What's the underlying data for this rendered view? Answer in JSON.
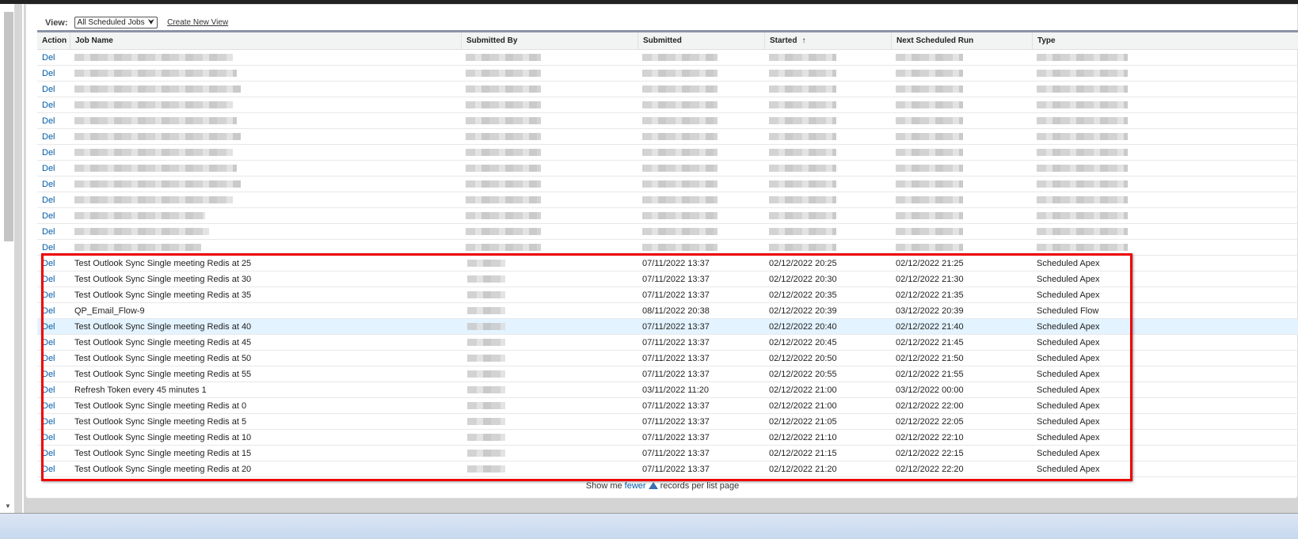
{
  "view": {
    "label": "View:",
    "selected": "All Scheduled Jobs",
    "create_link": "Create New View"
  },
  "columns": [
    "Action",
    "Job Name",
    "Submitted By",
    "Submitted",
    "Started",
    "Next Scheduled Run",
    "Type"
  ],
  "sort_indicator": "↑",
  "del_label": "Del",
  "blurred_row_count": 13,
  "rows": [
    {
      "job": "Test Outlook Sync Single meeting Redis at 25",
      "submitted": "07/11/2022 13:37",
      "started": "02/12/2022 20:25",
      "next": "02/12/2022 21:25",
      "type": "Scheduled Apex"
    },
    {
      "job": "Test Outlook Sync Single meeting Redis at 30",
      "submitted": "07/11/2022 13:37",
      "started": "02/12/2022 20:30",
      "next": "02/12/2022 21:30",
      "type": "Scheduled Apex"
    },
    {
      "job": "Test Outlook Sync Single meeting Redis at 35",
      "submitted": "07/11/2022 13:37",
      "started": "02/12/2022 20:35",
      "next": "02/12/2022 21:35",
      "type": "Scheduled Apex"
    },
    {
      "job": "QP_Email_Flow-9",
      "submitted": "08/11/2022 20:38",
      "started": "02/12/2022 20:39",
      "next": "03/12/2022 20:39",
      "type": "Scheduled Flow"
    },
    {
      "job": "Test Outlook Sync Single meeting Redis at 40",
      "submitted": "07/11/2022 13:37",
      "started": "02/12/2022 20:40",
      "next": "02/12/2022 21:40",
      "type": "Scheduled Apex",
      "highlighted": true
    },
    {
      "job": "Test Outlook Sync Single meeting Redis at 45",
      "submitted": "07/11/2022 13:37",
      "started": "02/12/2022 20:45",
      "next": "02/12/2022 21:45",
      "type": "Scheduled Apex"
    },
    {
      "job": "Test Outlook Sync Single meeting Redis at 50",
      "submitted": "07/11/2022 13:37",
      "started": "02/12/2022 20:50",
      "next": "02/12/2022 21:50",
      "type": "Scheduled Apex"
    },
    {
      "job": "Test Outlook Sync Single meeting Redis at 55",
      "submitted": "07/11/2022 13:37",
      "started": "02/12/2022 20:55",
      "next": "02/12/2022 21:55",
      "type": "Scheduled Apex"
    },
    {
      "job": "Refresh Token every 45 minutes 1",
      "submitted": "03/11/2022 11:20",
      "started": "02/12/2022 21:00",
      "next": "03/12/2022 00:00",
      "type": "Scheduled Apex"
    },
    {
      "job": "Test Outlook Sync Single meeting Redis at 0",
      "submitted": "07/11/2022 13:37",
      "started": "02/12/2022 21:00",
      "next": "02/12/2022 22:00",
      "type": "Scheduled Apex"
    },
    {
      "job": "Test Outlook Sync Single meeting Redis at 5",
      "submitted": "07/11/2022 13:37",
      "started": "02/12/2022 21:05",
      "next": "02/12/2022 22:05",
      "type": "Scheduled Apex"
    },
    {
      "job": "Test Outlook Sync Single meeting Redis at 10",
      "submitted": "07/11/2022 13:37",
      "started": "02/12/2022 21:10",
      "next": "02/12/2022 22:10",
      "type": "Scheduled Apex"
    },
    {
      "job": "Test Outlook Sync Single meeting Redis at 15",
      "submitted": "07/11/2022 13:37",
      "started": "02/12/2022 21:15",
      "next": "02/12/2022 22:15",
      "type": "Scheduled Apex"
    },
    {
      "job": "Test Outlook Sync Single meeting Redis at 20",
      "submitted": "07/11/2022 13:37",
      "started": "02/12/2022 21:20",
      "next": "02/12/2022 22:20",
      "type": "Scheduled Apex"
    }
  ],
  "footer": {
    "prefix": "Show me",
    "link": "fewer",
    "suffix": "records per list page"
  },
  "colors": {
    "link": "#015ba7",
    "highlight_box": "#ee0000",
    "row_hover": "#e3f3ff"
  }
}
